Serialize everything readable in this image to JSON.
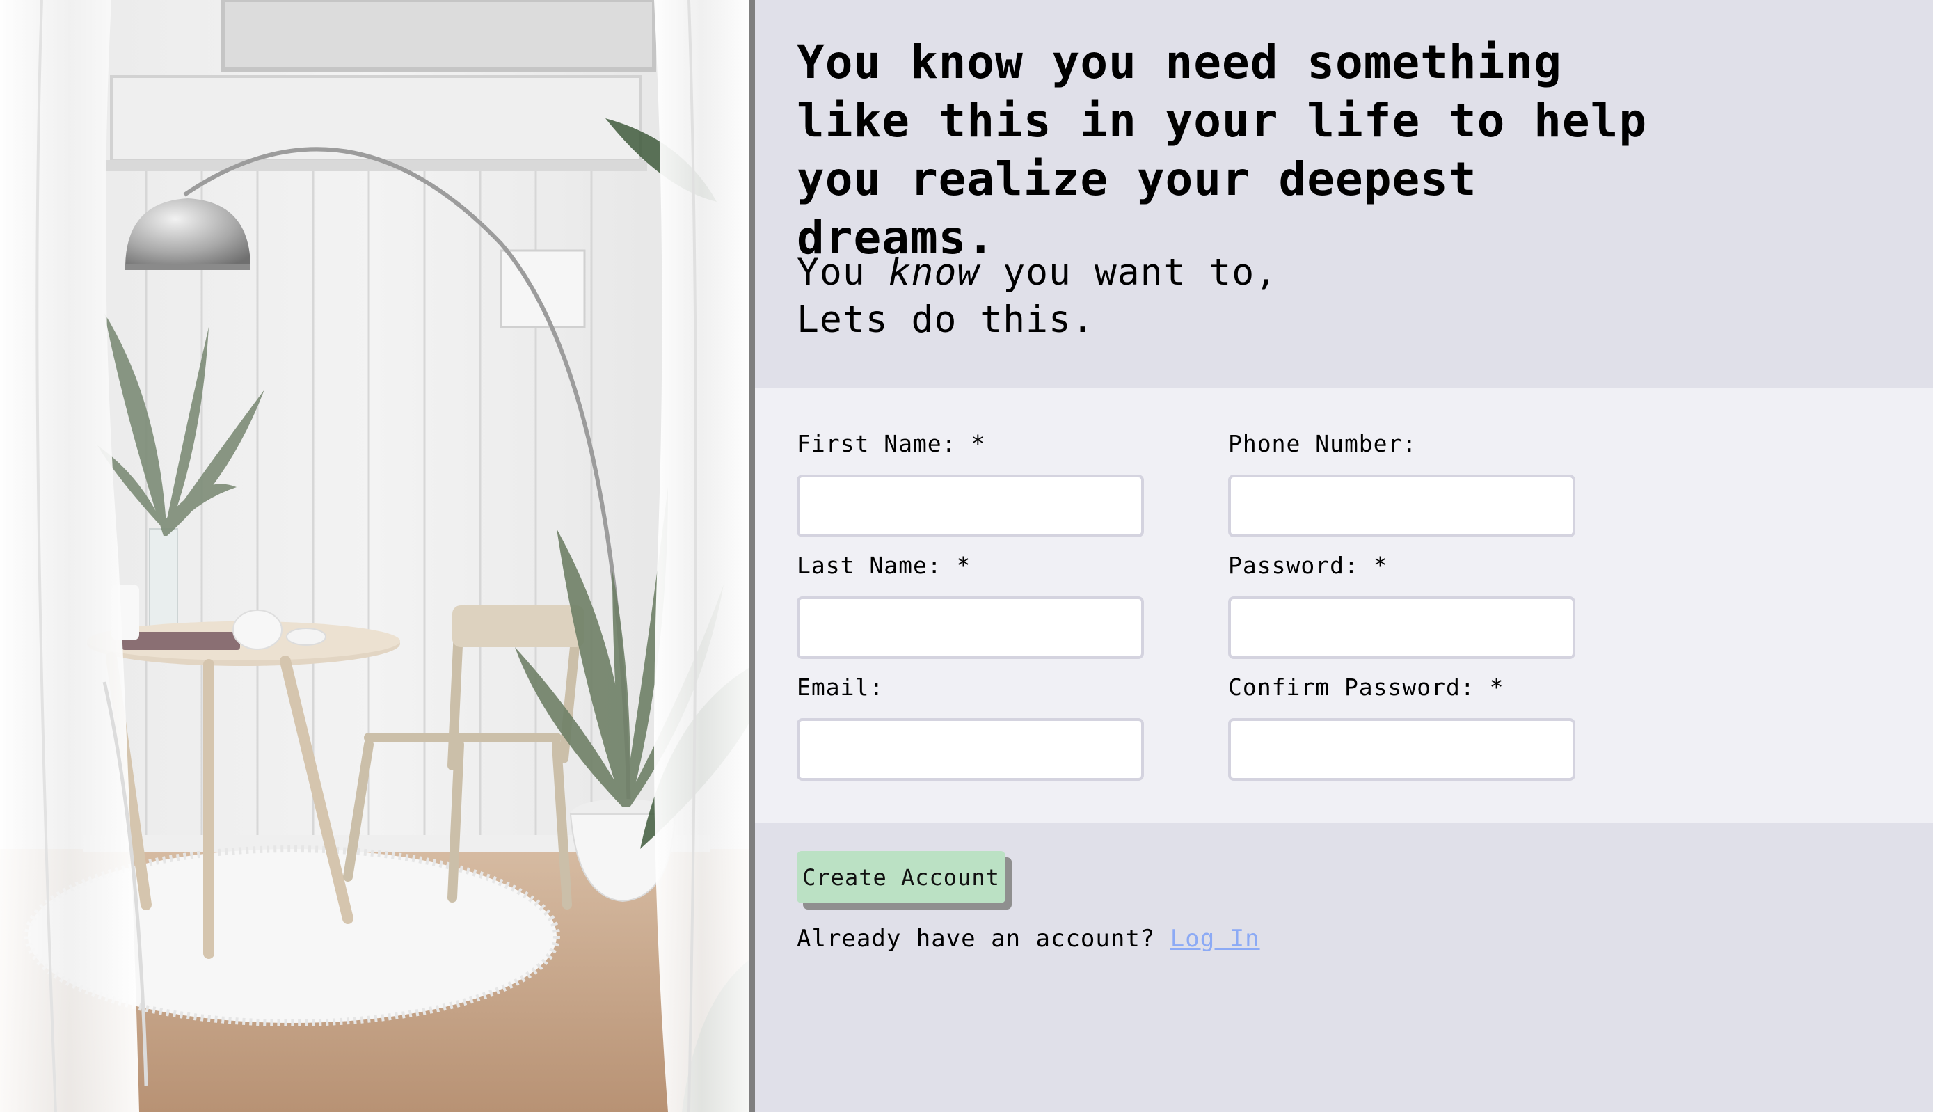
{
  "hero": {
    "headline": "You know you need something like this in your life to help you realize your deepest dreams.",
    "tagline_start": "You ",
    "tagline_emphasis": "know",
    "tagline_end": " you want to,",
    "tagline_line2": "Lets do this."
  },
  "form": {
    "fields": [
      {
        "label": "First Name: *",
        "value": "",
        "placeholder": ""
      },
      {
        "label": "Phone Number:",
        "value": "",
        "placeholder": ""
      },
      {
        "label": "Last Name: *",
        "value": "",
        "placeholder": ""
      },
      {
        "label": "Password: *",
        "value": "",
        "placeholder": ""
      },
      {
        "label": "Email:",
        "value": "",
        "placeholder": ""
      },
      {
        "label": "Confirm Password: *",
        "value": "",
        "placeholder": ""
      }
    ]
  },
  "actions": {
    "create_account_label": "Create Account",
    "login_prompt": "Already have an account? ",
    "login_link": "Log In"
  },
  "colors": {
    "hero_background": "#e0e0e9",
    "form_background": "#f0f0f5",
    "button_background": "#bbe1c4",
    "link": "#8caaf5",
    "divider": "#7f7f7f"
  },
  "photo": {
    "icons": [
      "room-photo"
    ]
  }
}
